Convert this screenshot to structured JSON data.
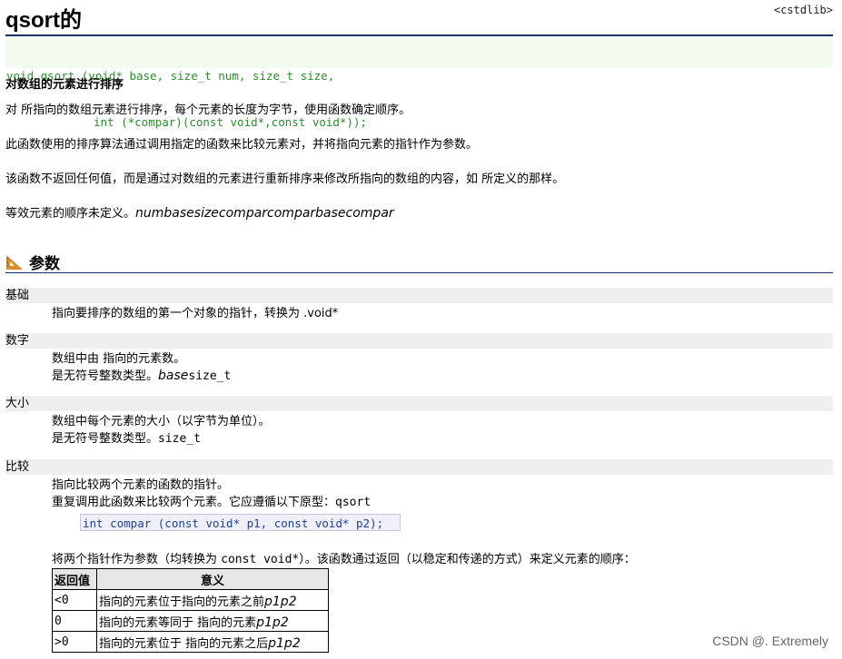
{
  "page": {
    "title": "qsort的",
    "header_tag": "<cstdlib>",
    "prototype_line1": "void qsort (void* base, size_t num, size_t size,",
    "prototype_line2": "int (*compar)(const void*,const void*));",
    "subtitle": "对数组的元素进行排序",
    "para1": "对 所指向的数组元素进行排序，每个元素的长度为字节，使用函数确定顺序。",
    "para2": "此函数使用的排序算法通过调用指定的函数来比较元素对，并将指向元素的指针作为参数。",
    "para3": "该函数不返回任何值，而是通过对数组的元素进行重新排序来修改所指向的数组的内容，如 所定义的那样。",
    "para4_text": "等效元素的顺序未定义。",
    "para4_italic": "numbasesizecomparcomparbasecompar"
  },
  "params_section": {
    "heading": "参数",
    "heading_icon": "ruler-triangle-icon",
    "base": {
      "name": "基础",
      "line1": "指向要排序的数组的第一个对象的指针，转换为 .void*"
    },
    "num": {
      "name": "数字",
      "line1": "数组中由 指向的元素数。",
      "line2_text": "是无符号整数类型。",
      "line2_italic": "base",
      "line2_code": "size_t"
    },
    "size": {
      "name": "大小",
      "line1": "数组中每个元素的大小（以字节为单位）。",
      "line2_text": "是无符号整数类型。",
      "line2_code": "size_t"
    },
    "compar": {
      "name": "比较",
      "line1": "指向比较两个元素的函数的指针。",
      "line2_text": "重复调用此函数来比较两个元素。它应遵循以下原型：",
      "line2_code": "qsort",
      "code_sample": "int compar (const void* p1, const void* p2);",
      "line3_text1": "将两个指针作为参数（均转换为 ",
      "line3_code": "const void*",
      "line3_text2": "）。该函数通过返回（以稳定和传递的方式）来定义元素的顺序："
    }
  },
  "return_table": {
    "headers": [
      "返回值",
      "意义"
    ],
    "rows": [
      {
        "value": "<0",
        "meaning": "指向的元素位于指向的元素之前",
        "italic": "p1p2"
      },
      {
        "value": "0",
        "meaning": "指向的元素等同于 指向的元素",
        "italic": "p1p2"
      },
      {
        "value": ">0",
        "meaning": "指向的元素位于 指向的元素之后",
        "italic": "p1p2"
      }
    ]
  },
  "watermark": "CSDN @. Extremely",
  "colors": {
    "rule": "#1a2f63",
    "prototype_text": "#2d8c2d",
    "prototype_bg": "#f3fbf1",
    "param_bar": "#efefef",
    "code_text": "#1f3f9f",
    "icon": "#d98c2b"
  }
}
